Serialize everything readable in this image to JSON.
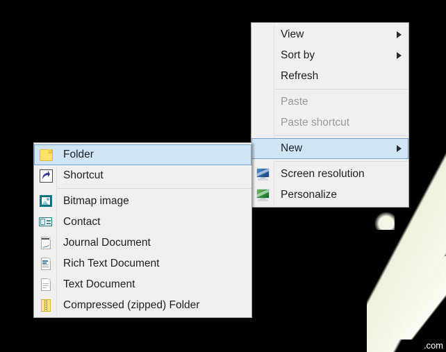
{
  "desktop": {
    "background_color": "#000000",
    "watermark_text": ".com"
  },
  "context_menu": {
    "name": "desktop-context-menu",
    "items": [
      {
        "label": "View",
        "icon": "",
        "submenu_arrow": true,
        "disabled": false,
        "highlighted": false,
        "separator_after": false
      },
      {
        "label": "Sort by",
        "icon": "",
        "submenu_arrow": true,
        "disabled": false,
        "highlighted": false,
        "separator_after": false
      },
      {
        "label": "Refresh",
        "icon": "",
        "submenu_arrow": false,
        "disabled": false,
        "highlighted": false,
        "separator_after": true
      },
      {
        "label": "Paste",
        "icon": "",
        "submenu_arrow": false,
        "disabled": true,
        "highlighted": false,
        "separator_after": false
      },
      {
        "label": "Paste shortcut",
        "icon": "",
        "submenu_arrow": false,
        "disabled": true,
        "highlighted": false,
        "separator_after": true
      },
      {
        "label": "New",
        "icon": "",
        "submenu_arrow": true,
        "disabled": false,
        "highlighted": true,
        "separator_after": true
      },
      {
        "label": "Screen resolution",
        "icon": "monitor-blue-icon",
        "submenu_arrow": false,
        "disabled": false,
        "highlighted": false,
        "separator_after": false
      },
      {
        "label": "Personalize",
        "icon": "monitor-green-icon",
        "submenu_arrow": false,
        "disabled": false,
        "highlighted": false,
        "separator_after": false
      }
    ]
  },
  "new_submenu": {
    "name": "new-submenu",
    "items": [
      {
        "label": "Folder",
        "icon": "folder-icon",
        "highlighted": true,
        "separator_after": false
      },
      {
        "label": "Shortcut",
        "icon": "shortcut-icon",
        "highlighted": false,
        "separator_after": true
      },
      {
        "label": "Bitmap image",
        "icon": "bitmap-image-icon",
        "highlighted": false,
        "separator_after": false
      },
      {
        "label": "Contact",
        "icon": "contact-icon",
        "highlighted": false,
        "separator_after": false
      },
      {
        "label": "Journal Document",
        "icon": "journal-document-icon",
        "highlighted": false,
        "separator_after": false
      },
      {
        "label": "Rich Text Document",
        "icon": "rich-text-document-icon",
        "highlighted": false,
        "separator_after": false
      },
      {
        "label": "Text Document",
        "icon": "text-document-icon",
        "highlighted": false,
        "separator_after": false
      },
      {
        "label": "Compressed (zipped) Folder",
        "icon": "compressed-folder-icon",
        "highlighted": false,
        "separator_after": false
      }
    ]
  },
  "colors": {
    "menu_background": "#f0f0f0",
    "menu_border": "#9a9a9a",
    "highlight_fill": "#cfe4f5",
    "highlight_border": "#7da2ce",
    "text": "#1f1f1f",
    "disabled_text": "#9a9a9a",
    "separator": "#dcdcdc"
  }
}
